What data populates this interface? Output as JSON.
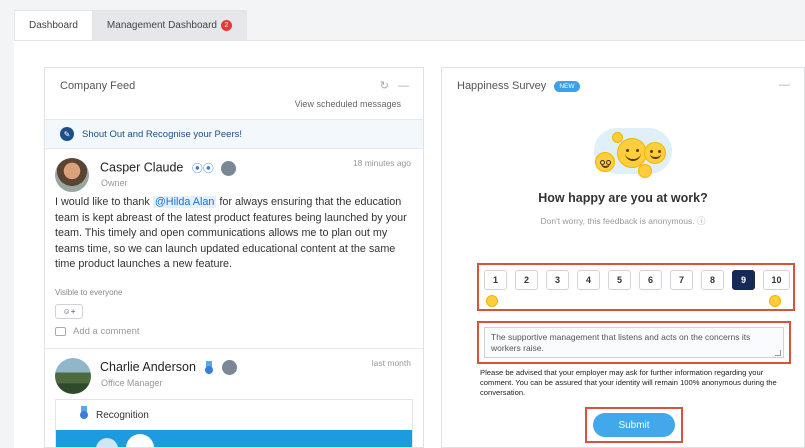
{
  "tabs": [
    {
      "label": "Dashboard"
    },
    {
      "label": "Management Dashboard",
      "badge": "2"
    }
  ],
  "feed": {
    "title": "Company Feed",
    "view_scheduled": "View scheduled messages",
    "shoutout": "Shout Out and Recognise your Peers!",
    "post1": {
      "name": "Casper Claude",
      "role": "Owner",
      "time": "18 minutes ago",
      "text_before": "I would like to thank ",
      "mention": "@Hilda Alan",
      "text_after": " for always ensuring that the education team is kept abreast of the latest product features being launched by your team. This timely and open communications allows me to plan out my teams time, so we can launch updated educational content at the same time product launches a new feature.",
      "visibility": "Visible to everyone",
      "react_label": "☺+",
      "add_comment": "Add a comment"
    },
    "post2": {
      "name": "Charlie Anderson",
      "role": "Office Manager",
      "time": "last month",
      "recognition_label": "Recognition"
    }
  },
  "survey": {
    "title": "Happiness Survey",
    "new_badge": "NEW",
    "question": "How happy are you at work?",
    "anon_note": "Don't worry, this feedback is anonymous. ⓘ",
    "scale": [
      "1",
      "2",
      "3",
      "4",
      "5",
      "6",
      "7",
      "8",
      "9",
      "10"
    ],
    "selected": "9",
    "comment": "The supportive management that listens and acts on the concerns its workers raise.",
    "advice": "Please be advised that your employer may ask for further information regarding your comment. You can be assured that your identity will remain 100% anonymous during the conversation.",
    "submit_label": "Submit"
  },
  "colors": {
    "accent": "#41a8ec",
    "selected_scale": "#172a55",
    "highlight_border": "#d9533a",
    "badge_red": "#e53935"
  }
}
